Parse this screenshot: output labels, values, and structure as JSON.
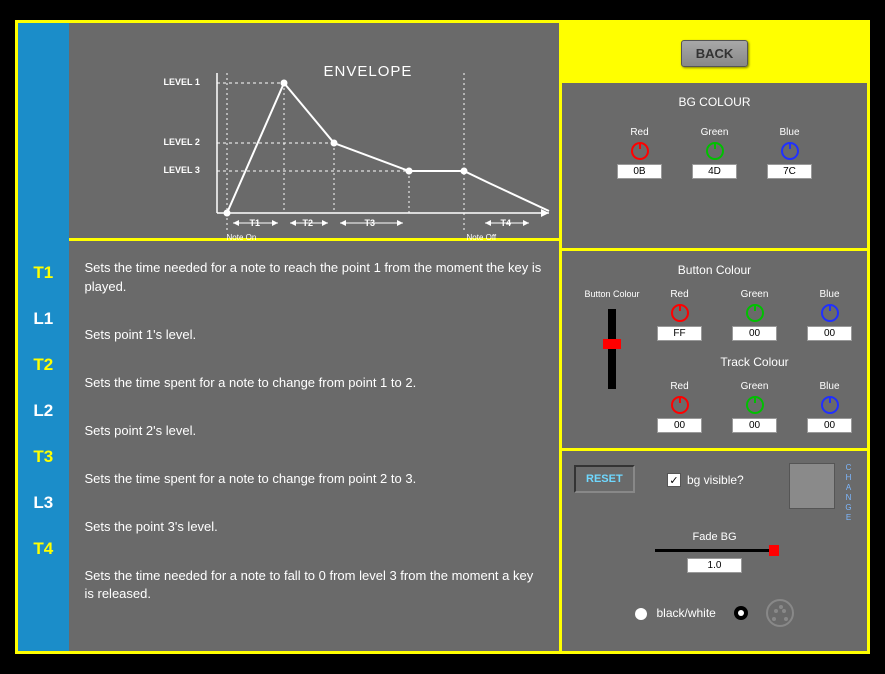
{
  "back_button": "BACK",
  "diagram": {
    "title": "ENVELOPE",
    "level1": "LEVEL 1",
    "level2": "LEVEL 2",
    "level3": "LEVEL 3",
    "t1": "T1",
    "t2": "T2",
    "t3": "T3",
    "t4": "T4",
    "note_on": "Note On",
    "note_off": "Note Off"
  },
  "rail": {
    "t1": "T1",
    "l1": "L1",
    "t2": "T2",
    "l2": "L2",
    "t3": "T3",
    "l3": "L3",
    "t4": "T4"
  },
  "descriptions": {
    "t1": "Sets the time needed for a note to reach the point 1 from the moment the key is played.",
    "l1": "Sets point 1's level.",
    "t2": "Sets the time spent for a note to change from  point 1 to 2.",
    "l2": "Sets point 2's level.",
    "t3": "Sets the time spent for a note to change from  point 2 to 3.",
    "l3": "Sets the point 3's level.",
    "t4": "Sets the time needed for a note to fall to 0 from  level 3 from the moment a key is released."
  },
  "bg_colour": {
    "title": "BG COLOUR",
    "red_label": "Red",
    "green_label": "Green",
    "blue_label": "Blue",
    "red": "0B",
    "green": "4D",
    "blue": "7C"
  },
  "button_colour": {
    "title": "Button Colour",
    "slider_label": "Button Colour",
    "red_label": "Red",
    "green_label": "Green",
    "blue_label": "Blue",
    "red": "FF",
    "green": "00",
    "blue": "00"
  },
  "track_colour": {
    "title": "Track Colour",
    "red_label": "Red",
    "green_label": "Green",
    "blue_label": "Blue",
    "red": "00",
    "green": "00",
    "blue": "00"
  },
  "bottom": {
    "reset": "RESET",
    "bg_visible": "bg visible?",
    "change": "CHANGE",
    "fade_label": "Fade BG",
    "fade_value": "1.0",
    "bw_label": "black/white"
  }
}
